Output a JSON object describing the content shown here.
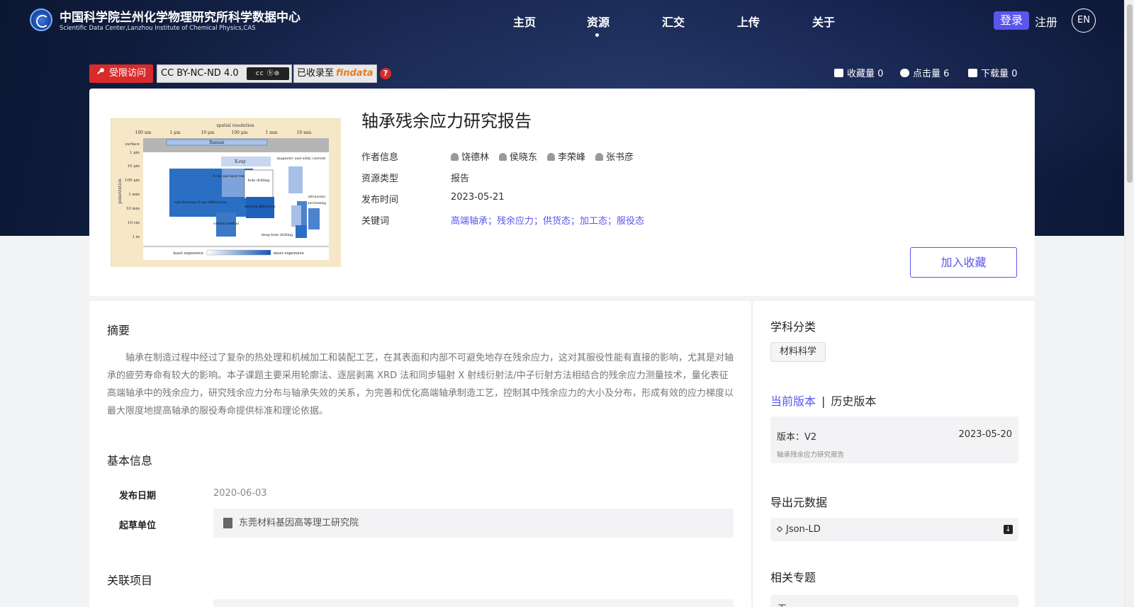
{
  "header": {
    "org_title": "中国科学院兰州化学物理研究所科学数据中心",
    "org_subtitle": "Scientific Data Center,Lanzhou Institute of Chemical Physics,CAS",
    "nav": [
      "主页",
      "资源",
      "汇交",
      "上传",
      "关于"
    ],
    "active_nav": "资源",
    "login": "登录",
    "register": "注册",
    "lang": "EN"
  },
  "badges": {
    "restricted": "受限访问",
    "license": "CC BY-NC-ND 4.0",
    "indexed": "已收录至",
    "findata": "findata",
    "help": "?"
  },
  "stats": {
    "favorites": "收藏量 0",
    "clicks": "点击量 6",
    "downloads": "下载量 0"
  },
  "resource": {
    "title": "轴承残余应力研究报告",
    "labels": {
      "authors": "作者信息",
      "type": "资源类型",
      "published": "发布时间",
      "keywords": "关键词"
    },
    "authors": [
      "饶德林",
      "侯晓东",
      "李荣峰",
      "张书彦"
    ],
    "type": "报告",
    "published": "2023-05-21",
    "keywords": "高端轴承；残余应力；供货态；加工态；服役态",
    "favorite_button": "加入收藏"
  },
  "thumbnail": {
    "top_axis_label": "spatial resolution",
    "top_ticks": [
      "100 nm",
      "1 μm",
      "10 μm",
      "100 μm",
      "1 mm",
      "10 mm"
    ],
    "left_axis_label": "penetration",
    "left_ticks": [
      "surface",
      "1 μm",
      "10 μm",
      "100 μm",
      "1 mm",
      "10 mm",
      "10 cm",
      "1 m"
    ],
    "regions": [
      "Raman",
      "X-ray",
      "magnetic and eddy current",
      "X-ray and layer removal",
      "hole drilling",
      "synchrotron X-ray diffraction",
      "ultrasonic",
      "sectioning",
      "neutron diffraction",
      "contour method",
      "deep-hole drilling"
    ],
    "legend_low": "least expensive",
    "legend_high": "most expensive"
  },
  "main": {
    "abstract_title": "摘要",
    "abstract": "轴承在制造过程中经过了复杂的热处理和机械加工和装配工艺，在其表面和内部不可避免地存在残余应力，这对其服役性能有直接的影响，尤其是对轴承的疲劳寿命有较大的影响。本子课题主要采用轮廓法、逐层剥离 XRD 法和同步辐射 X 射线衍射法/中子衍射方法相结合的残余应力测量技术，量化表征高端轴承中的残余应力，研究残余应力分布与轴承失效的关系，为完善和优化高端轴承制造工艺，控制其中残余应力的大小及分布，形成有效的应力梯度以最大限度地提高轴承的服役寿命提供标准和理论依据。",
    "basic_info_title": "基本信息",
    "release_date_label": "发布日期",
    "release_date": "2020-06-03",
    "draft_unit_label": "起草单位",
    "draft_unit": "东莞材料基因高等理工研究院",
    "related_projects_title": "关联项目"
  },
  "side": {
    "subject_title": "学科分类",
    "subject_tag": "材料科学",
    "current_version": "当前版本",
    "history_version": "历史版本",
    "version_label": "版本：V2",
    "version_date": "2023-05-20",
    "version_desc": "轴承残余应力研究报告",
    "export_title": "导出元数据",
    "export_format": "Json-LD",
    "topics_title": "相关专题",
    "topics_value": "无"
  },
  "colors": {
    "accent": "#5b55f0",
    "restricted_badge": "#d92b2b",
    "header_bg": "#13204a"
  }
}
